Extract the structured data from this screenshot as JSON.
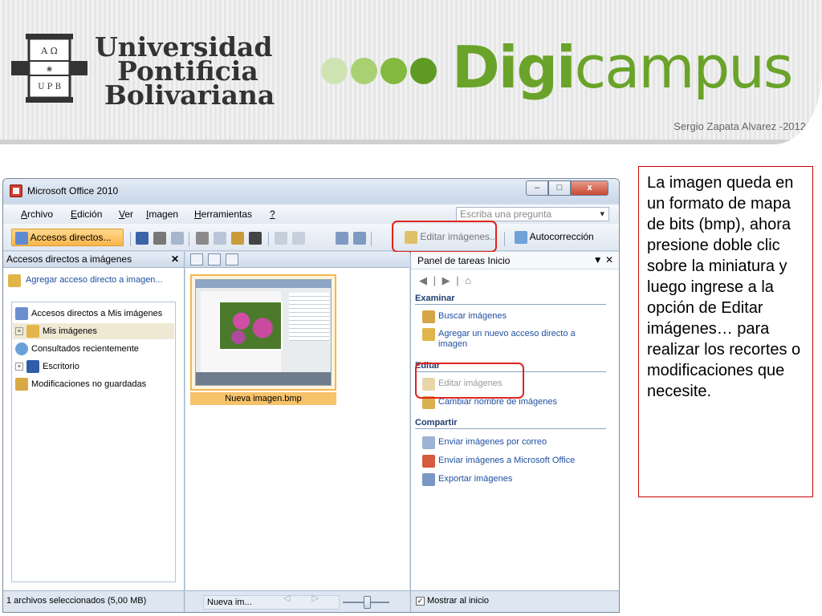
{
  "slide": {
    "university": {
      "line1": "Universidad",
      "line2": "Pontificia",
      "line3": "Bolivariana"
    },
    "logo_text": {
      "top": "Α Ω",
      "middle": "❀",
      "bottom": "U P B"
    },
    "brand": {
      "digi": "Digi",
      "campus": "campus"
    },
    "author": "Sergio Zapata Alvarez -2012",
    "callout": "La imagen queda en un formato de mapa de bits (bmp), ahora presione doble clic sobre la miniatura y luego ingrese a la opción de Editar imágenes… para realizar los recortes o modificaciones que necesite.",
    "colors": {
      "brand_green": "#6aa329",
      "dot_colors": [
        "#cfe3b2",
        "#a9d072",
        "#83b93f",
        "#5f9b24"
      ],
      "highlight_red": "#e0241c"
    }
  },
  "window": {
    "title": "Microsoft Office 2010",
    "caption_buttons": {
      "minimize": "–",
      "maximize": "□",
      "close": "x"
    },
    "menu": [
      {
        "pre": "",
        "u": "A",
        "post": "rchivo"
      },
      {
        "pre": "",
        "u": "E",
        "post": "dición"
      },
      {
        "pre": "",
        "u": "V",
        "post": "er"
      },
      {
        "pre": "",
        "u": "I",
        "post": "magen"
      },
      {
        "pre": "",
        "u": "H",
        "post": "erramientas"
      },
      {
        "pre": "",
        "u": "?",
        "post": ""
      }
    ],
    "ask_placeholder": "Escriba una pregunta",
    "toolbar": {
      "shortcuts": "Accesos directos...",
      "edit_images": "Editar imágenes...",
      "autocorrect": "Autocorrección"
    },
    "left_pane": {
      "title": "Accesos directos a imágenes",
      "close": "✕",
      "add_shortcut": "Agregar acceso directo a imagen...",
      "tree": [
        {
          "label": "Accesos directos a Mis imágenes",
          "expander": ""
        },
        {
          "label": "Mis imágenes",
          "expander": "+"
        },
        {
          "label": "Consultados recientemente",
          "expander": ""
        },
        {
          "label": "Escritorio",
          "expander": "+"
        },
        {
          "label": "Modificaciones no guardadas",
          "expander": ""
        }
      ],
      "status": "1 archivos seleccionados (5,00 MB)"
    },
    "center_pane": {
      "thumbnail_label": "Nueva imagen.bmp",
      "name_field": "Nueva im...",
      "nav_arrows": "◁ ▷"
    },
    "task_pane": {
      "title": "Panel de tareas Inicio",
      "controls": "▼ ✕",
      "nav": "◀ | ▶ | ⌂",
      "sections": {
        "examinar": "Examinar",
        "editar": "Editar",
        "compartir": "Compartir"
      },
      "tasks": {
        "buscar": "Buscar imágenes",
        "agregar": "Agregar un nuevo acceso directo a imagen",
        "editar_img": "Editar imágenes",
        "renombrar": "Cambiar nombre de imágenes",
        "correo": "Enviar imágenes por correo",
        "office": "Enviar imágenes a Microsoft Office",
        "exportar": "Exportar imágenes"
      },
      "show_at_start": "Mostrar al inicio",
      "show_at_start_checked": "✓"
    }
  }
}
